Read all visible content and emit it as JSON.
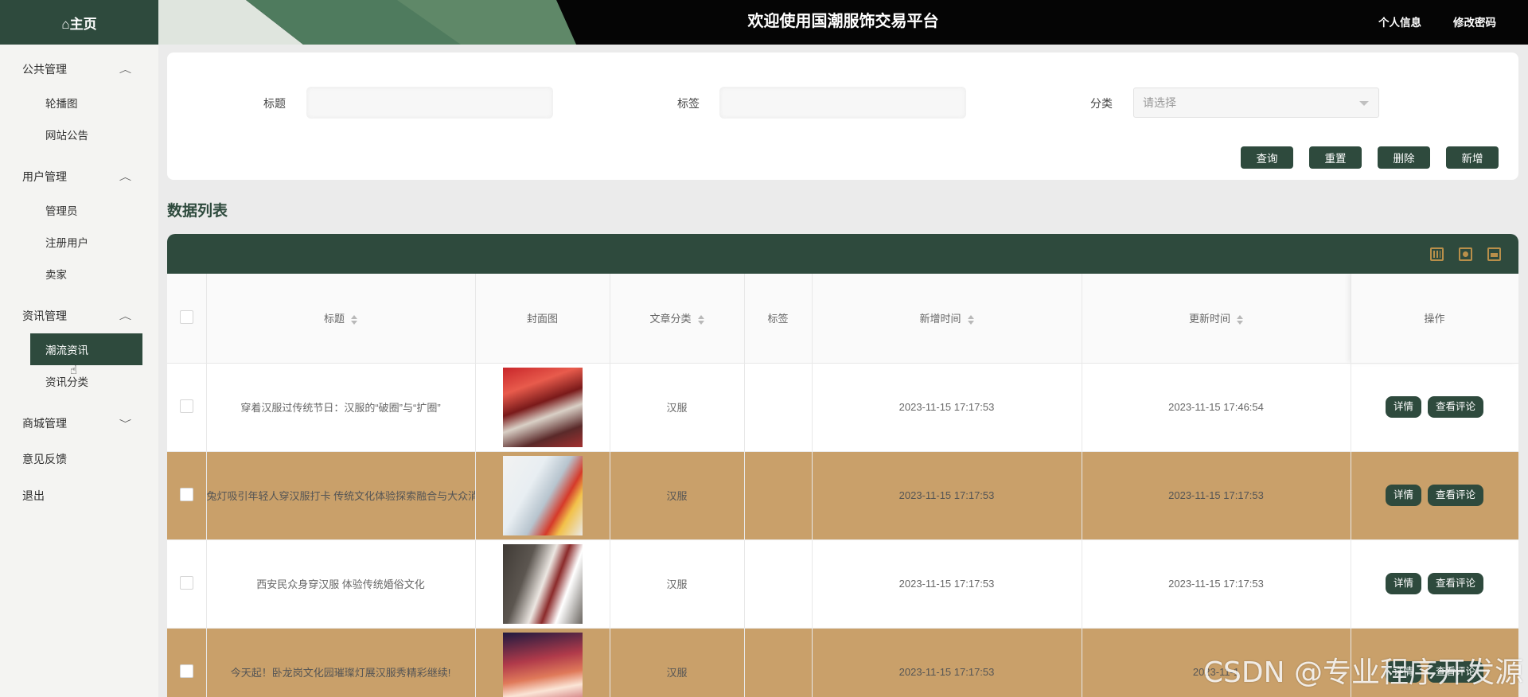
{
  "brand": {
    "icon": "home-icon",
    "label": "⌂主页"
  },
  "header": {
    "title": "欢迎使用国潮服饰交易平台",
    "links": [
      "个人信息",
      "修改密码"
    ]
  },
  "sidebar": {
    "groups": [
      {
        "title": "公共管理",
        "expanded": true,
        "items": [
          "轮播图",
          "网站公告"
        ]
      },
      {
        "title": "用户管理",
        "expanded": true,
        "items": [
          "管理员",
          "注册用户",
          "卖家"
        ]
      },
      {
        "title": "资讯管理",
        "expanded": true,
        "items": [
          "潮流资讯",
          "资讯分类"
        ],
        "active": "潮流资讯"
      },
      {
        "title": "商城管理",
        "expanded": false,
        "items": []
      }
    ],
    "plain_items": [
      "意见反馈",
      "退出"
    ]
  },
  "search": {
    "title_label": "标题",
    "tag_label": "标签",
    "category_label": "分类",
    "category_placeholder": "请选择",
    "buttons": [
      "查询",
      "重置",
      "删除",
      "新增"
    ]
  },
  "list_title": "数据列表",
  "table": {
    "headers": [
      "标题",
      "封面图",
      "文章分类",
      "标签",
      "新增时间",
      "更新时间",
      "操作"
    ],
    "rows": [
      {
        "title": "穿着汉服过传统节日：汉服的“破圈”与“扩圈”",
        "category": "汉服",
        "tag": "",
        "created": "2023-11-15 17:17:53",
        "updated": "2023-11-15 17:46:54"
      },
      {
        "title": "兔灯吸引年轻人穿汉服打卡 传统文化体验探索融合与大众消费",
        "category": "汉服",
        "tag": "",
        "created": "2023-11-15 17:17:53",
        "updated": "2023-11-15 17:17:53"
      },
      {
        "title": "西安民众身穿汉服 体验传统婚俗文化",
        "category": "汉服",
        "tag": "",
        "created": "2023-11-15 17:17:53",
        "updated": "2023-11-15 17:17:53"
      },
      {
        "title": "今天起！卧龙岗文化园璀璨灯展汉服秀精彩继续!",
        "category": "汉服",
        "tag": "",
        "created": "2023-11-15 17:17:53",
        "updated": "2023-11-1"
      }
    ],
    "actions": [
      "详情",
      "查看评论"
    ]
  },
  "watermark": "CSDN @专业程序开发源",
  "colors": {
    "primary": "#2e4a3d",
    "row_alt": "#c9a06a",
    "header_bg": "#050505"
  }
}
